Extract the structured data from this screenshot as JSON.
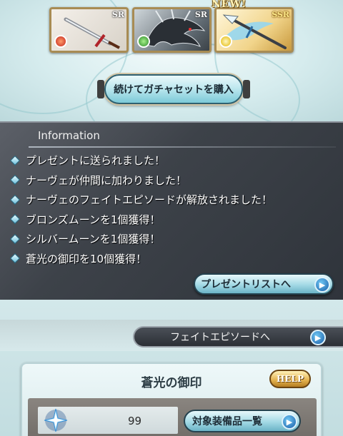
{
  "summon": {
    "cards": [
      {
        "rarity": "SR",
        "element": "fire",
        "item": "sword-icon"
      },
      {
        "rarity": "SR",
        "element": "wind",
        "item": "dragon-icon"
      },
      {
        "rarity": "SSR",
        "element": "light",
        "item": "spear-icon"
      }
    ],
    "new_badge": "NEW!",
    "buy_again_label": "続けてガチャセットを購入"
  },
  "information": {
    "title": "Information",
    "items": [
      "プレゼントに送られました！",
      "ナーヴェが仲間に加わりました！",
      "ナーヴェのフェイトエピソードが解放されました！",
      "ブロンズムーンを1個獲得！",
      "シルバームーンを1個獲得！",
      "蒼光の御印を10個獲得！"
    ],
    "present_list_label": "プレゼントリストへ"
  },
  "fate": {
    "label": "フェイトエピソードへ"
  },
  "seal": {
    "title": "蒼光の御印",
    "help_label": "HELP",
    "count": "99",
    "equipment_list_label": "対象装備品一覧"
  },
  "colors": {
    "accent_blue": "#6ec6f3",
    "panel_dark": "#3d4249",
    "gold": "#e2b04d"
  }
}
